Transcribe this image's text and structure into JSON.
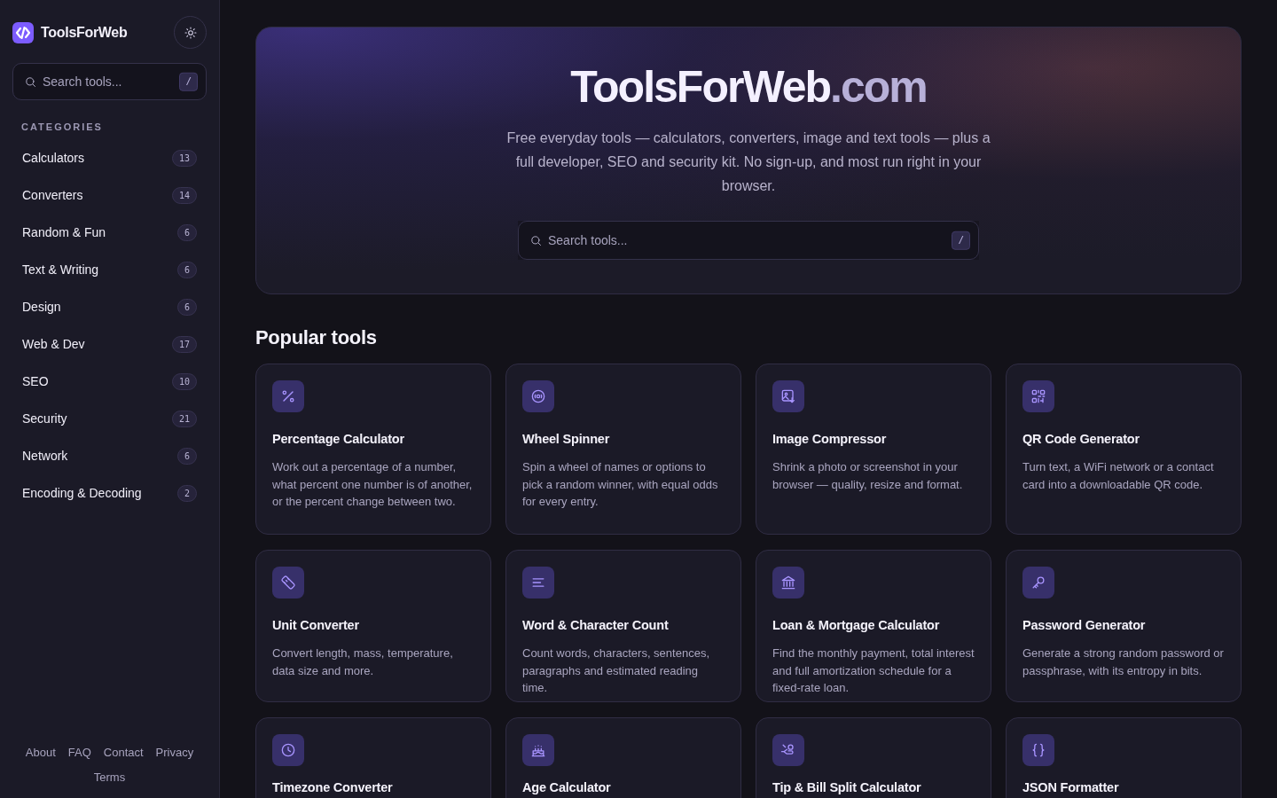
{
  "brand": {
    "name": "ToolsForWeb"
  },
  "sidebar": {
    "search": {
      "placeholder": "Search tools...",
      "shortcut": "/"
    },
    "heading": "CATEGORIES",
    "items": [
      {
        "label": "Calculators",
        "count": "13"
      },
      {
        "label": "Converters",
        "count": "14"
      },
      {
        "label": "Random & Fun",
        "count": "6"
      },
      {
        "label": "Text & Writing",
        "count": "6"
      },
      {
        "label": "Design",
        "count": "6"
      },
      {
        "label": "Web & Dev",
        "count": "17"
      },
      {
        "label": "SEO",
        "count": "10"
      },
      {
        "label": "Security",
        "count": "21"
      },
      {
        "label": "Network",
        "count": "6"
      },
      {
        "label": "Encoding & Decoding",
        "count": "2"
      }
    ],
    "footer_links": [
      "About",
      "FAQ",
      "Contact",
      "Privacy",
      "Terms"
    ]
  },
  "hero": {
    "title": "ToolsForWeb",
    "title_suffix": ".com",
    "subtitle": "Free everyday tools — calculators, converters, image and text tools — plus a full developer, SEO and security kit. No sign-up, and most run right in your browser.",
    "search": {
      "placeholder": "Search tools...",
      "shortcut": "/"
    }
  },
  "popular": {
    "heading": "Popular tools",
    "tools": [
      {
        "title": "Percentage Calculator",
        "description": "Work out a percentage of a number, what percent one number is of another, or the percent change between two."
      },
      {
        "title": "Wheel Spinner",
        "description": "Spin a wheel of names or options to pick a random winner, with equal odds for every entry."
      },
      {
        "title": "Image Compressor",
        "description": "Shrink a photo or screenshot in your browser — quality, resize and format."
      },
      {
        "title": "QR Code Generator",
        "description": "Turn text, a WiFi network or a contact card into a downloadable QR code."
      },
      {
        "title": "Unit Converter",
        "description": "Convert length, mass, temperature, data size and more."
      },
      {
        "title": "Word & Character Count",
        "description": "Count words, characters, sentences, paragraphs and estimated reading time."
      },
      {
        "title": "Loan & Mortgage Calculator",
        "description": "Find the monthly payment, total interest and full amortization schedule for a fixed-rate loan."
      },
      {
        "title": "Password Generator",
        "description": "Generate a strong random password or passphrase, with its entropy in bits."
      },
      {
        "title": "Timezone Converter"
      },
      {
        "title": "Age Calculator"
      },
      {
        "title": "Tip & Bill Split Calculator"
      },
      {
        "title": "JSON Formatter"
      }
    ]
  }
}
